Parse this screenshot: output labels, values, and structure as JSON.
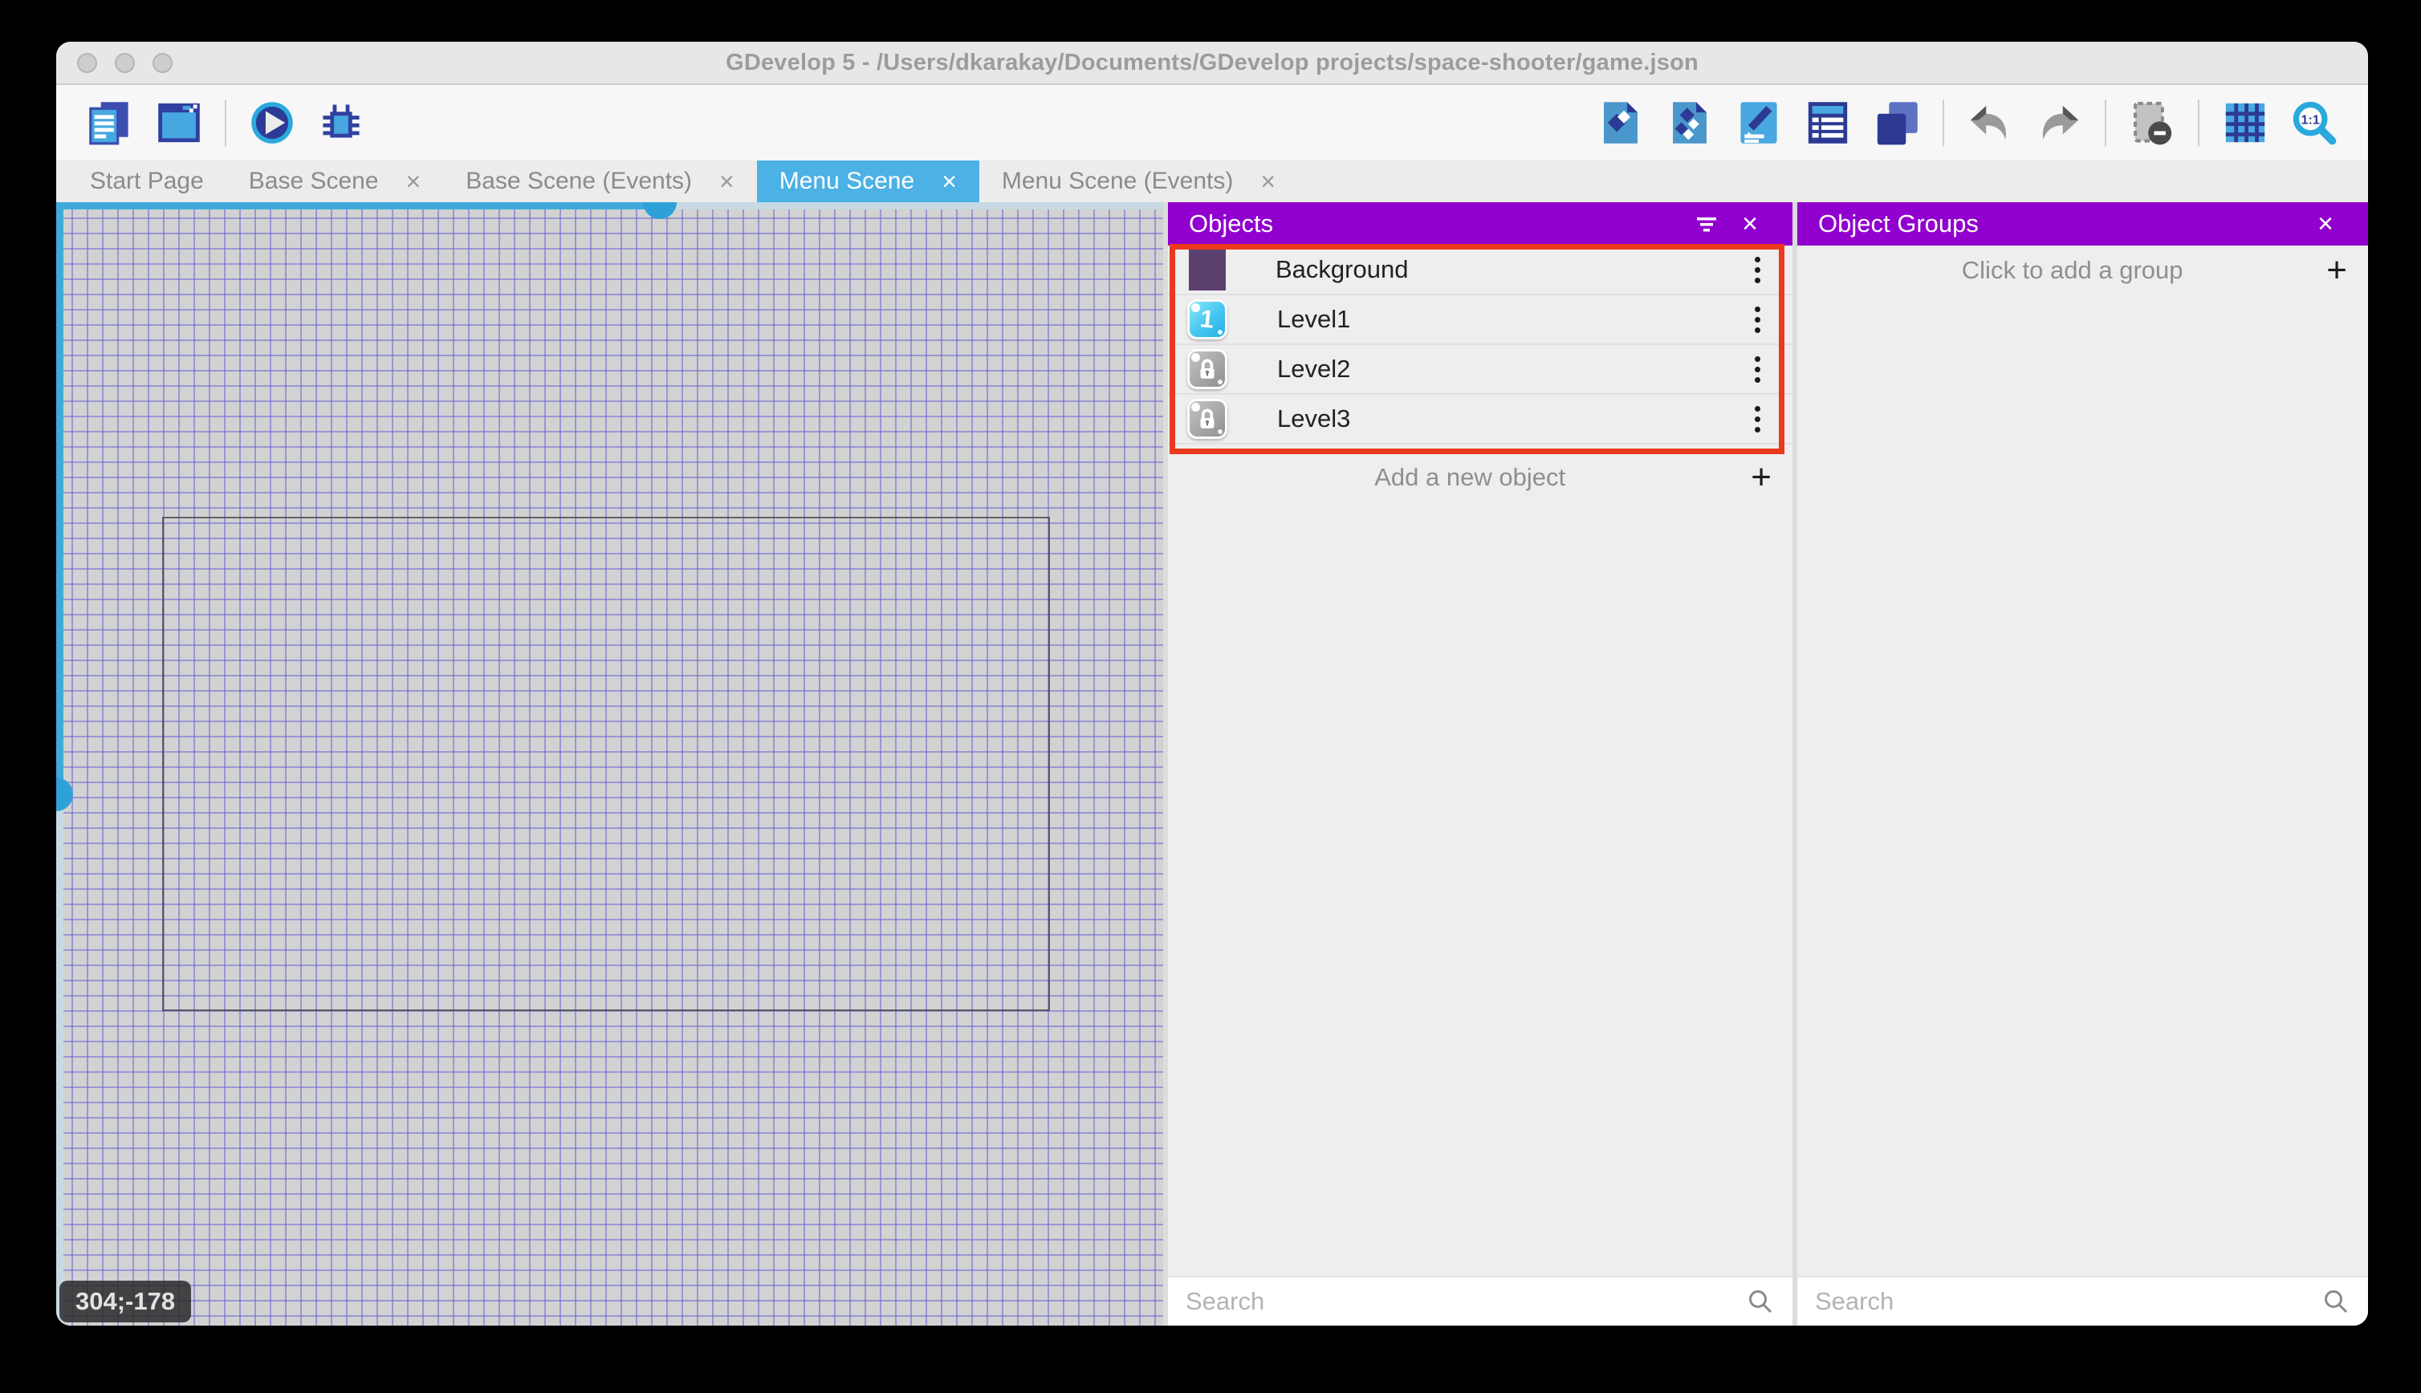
{
  "window": {
    "title": "GDevelop 5 - /Users/dkarakay/Documents/GDevelop projects/space-shooter/game.json"
  },
  "toolbar": {
    "left_icons": [
      "project-manager-icon",
      "preview-window-icon",
      "play-icon",
      "debug-icon"
    ],
    "right_icons": [
      "objects-editor-icon",
      "object-groups-editor-icon",
      "properties-icon",
      "instances-list-icon",
      "layers-icon",
      "undo-icon",
      "redo-icon",
      "render-mask-icon",
      "grid-icon",
      "zoom-original-icon"
    ],
    "zoom_original_label": "1:1"
  },
  "tabs": [
    {
      "label": "Start Page",
      "active": false,
      "closable": false
    },
    {
      "label": "Base Scene",
      "active": false,
      "closable": true
    },
    {
      "label": "Base Scene (Events)",
      "active": false,
      "closable": true
    },
    {
      "label": "Menu Scene",
      "active": true,
      "closable": true
    },
    {
      "label": "Menu Scene (Events)",
      "active": false,
      "closable": true
    }
  ],
  "canvas": {
    "coordinate_badge": "304;-178"
  },
  "objects_panel": {
    "title": "Objects",
    "items": [
      {
        "name": "Background"
      },
      {
        "name": "Level1",
        "badge": "1"
      },
      {
        "name": "Level2"
      },
      {
        "name": "Level3"
      }
    ],
    "add_label": "Add a new object",
    "search_placeholder": "Search"
  },
  "object_groups_panel": {
    "title": "Object Groups",
    "add_label": "Click to add a group",
    "search_placeholder": "Search"
  },
  "ui": {
    "close_glyph": "×",
    "plus_glyph": "+"
  },
  "colors": {
    "panel_header_purple": "#9100ce",
    "active_tab_blue": "#4cb1e4",
    "highlight_red": "#ea3a1e",
    "grid_line_blue": "#605cd6",
    "scrollbar_blue": "#2ea2d8",
    "background_thumb_purple": "#5c4170"
  }
}
